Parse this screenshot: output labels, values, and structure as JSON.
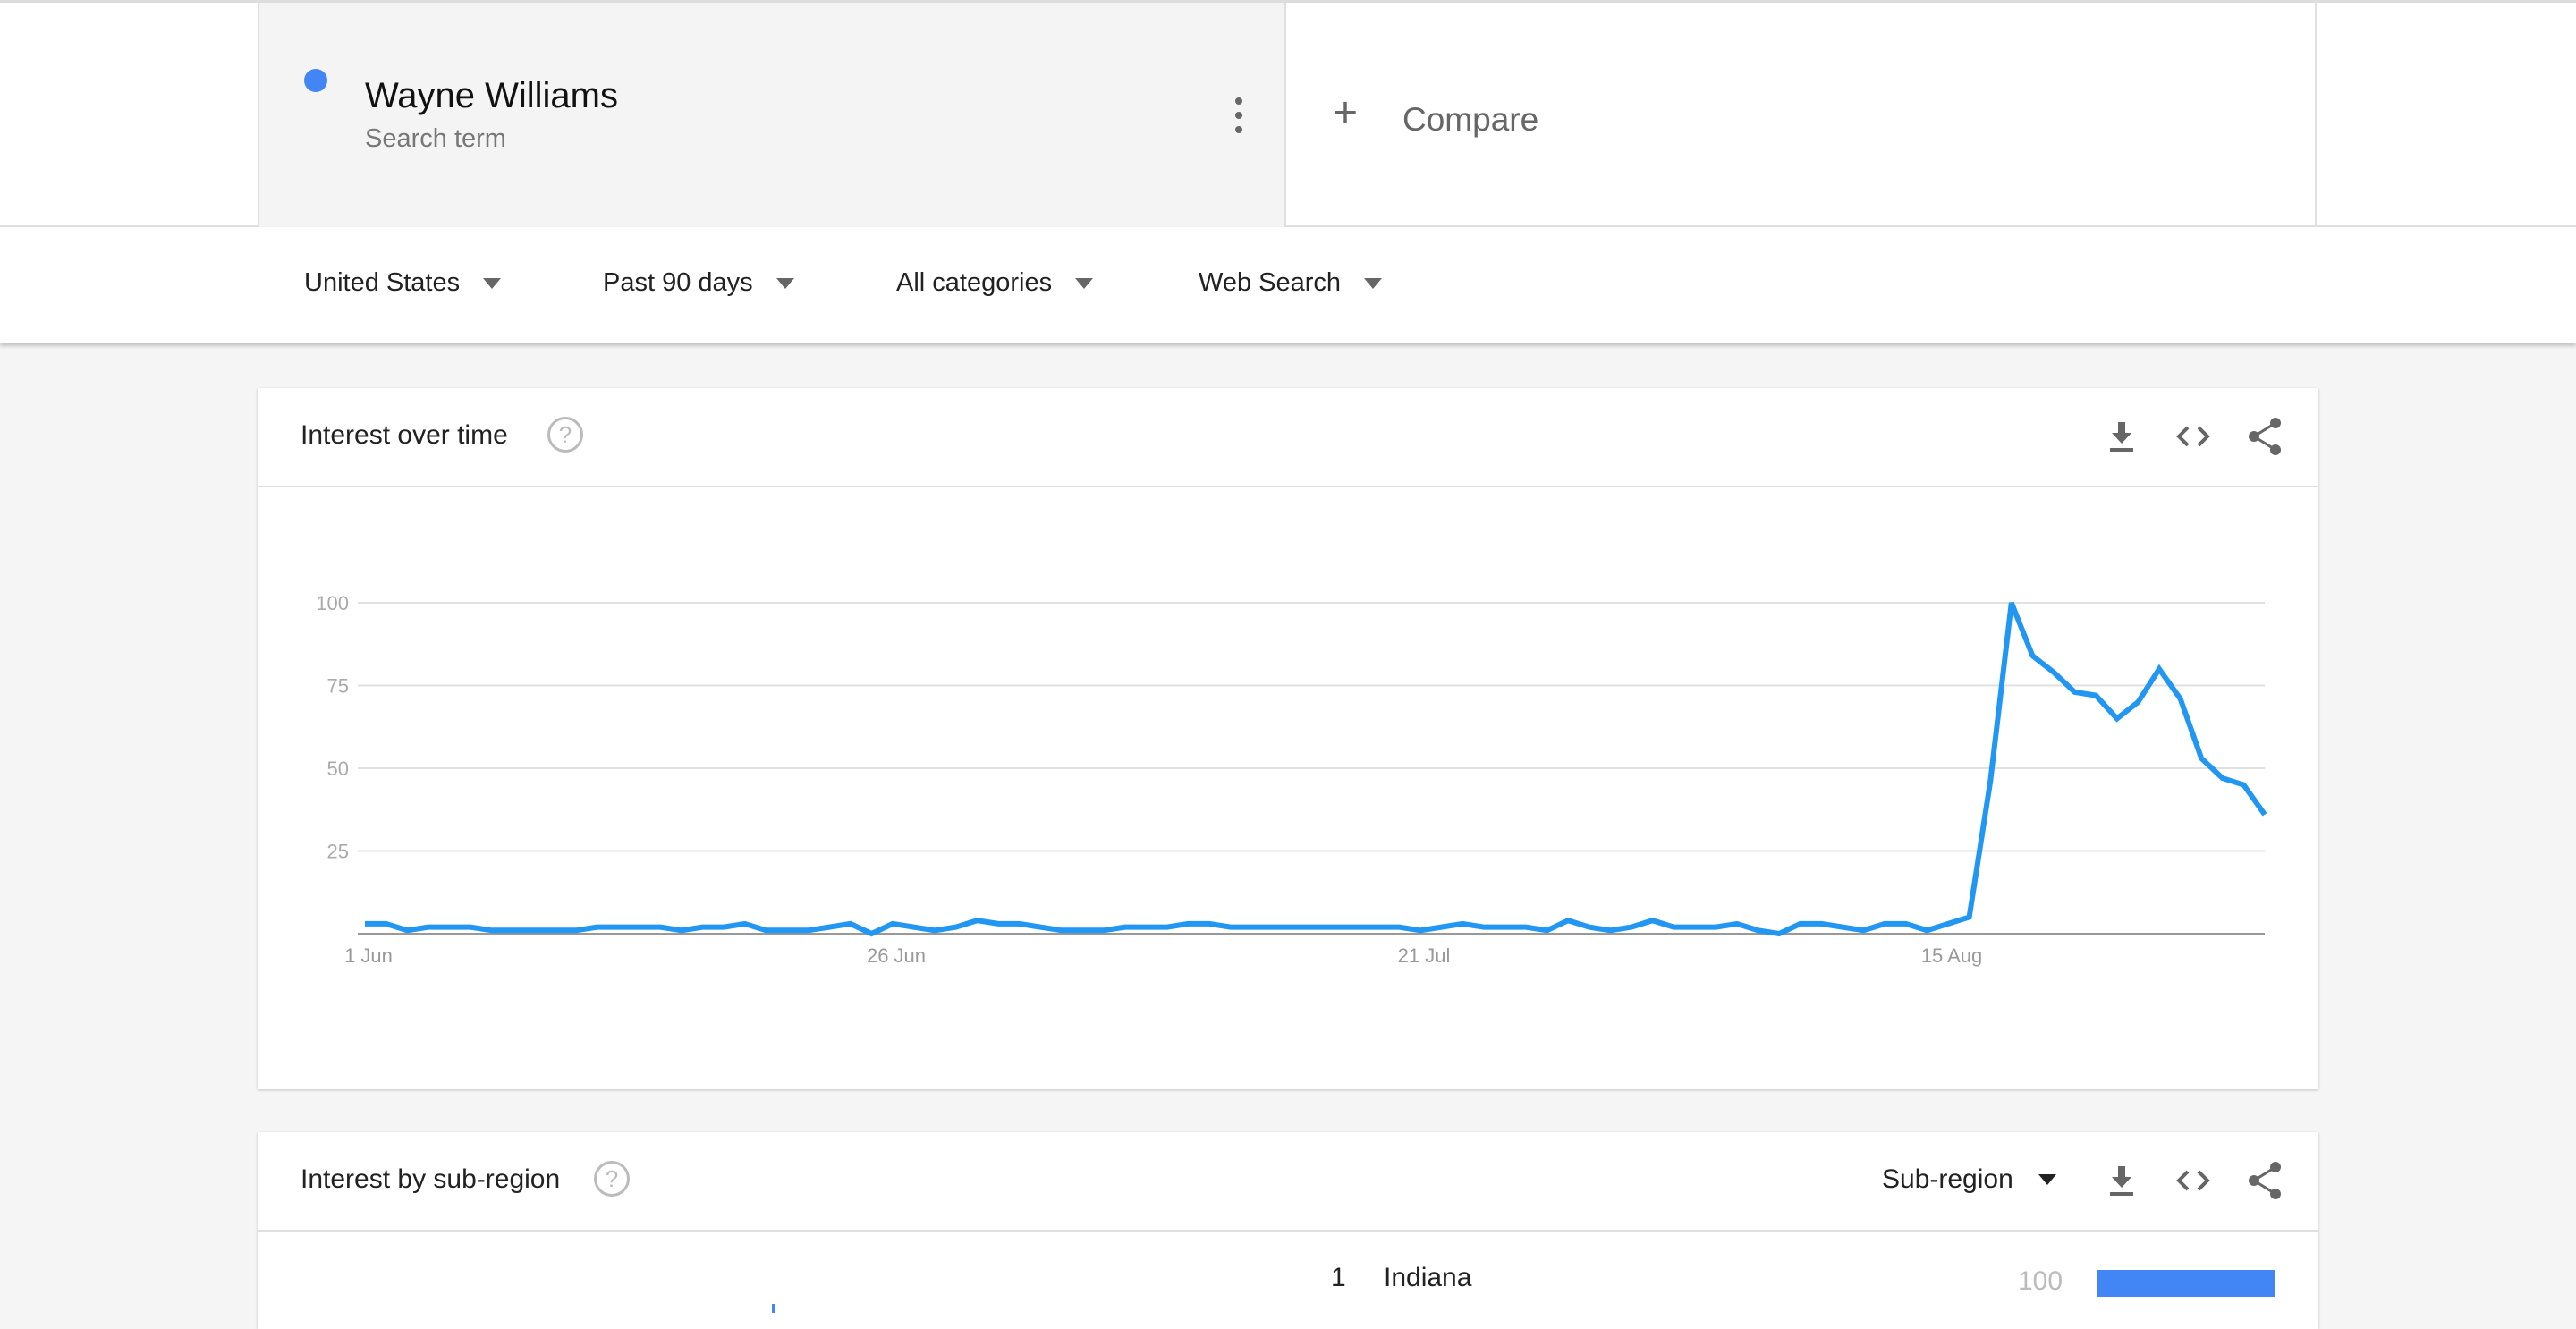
{
  "search_term": {
    "title": "Wayne Williams",
    "subtitle": "Search term",
    "color": "#4285f4"
  },
  "compare": {
    "label": "Compare"
  },
  "filters": [
    "United States",
    "Past 90 days",
    "All categories",
    "Web Search"
  ],
  "interest_over_time": {
    "title": "Interest over time",
    "help_icon": "question-circle-icon"
  },
  "interest_by_subregion": {
    "title": "Interest by sub-region",
    "selector": "Sub-region",
    "rows": [
      {
        "rank": "1",
        "name": "Indiana",
        "value": "100",
        "fraction": 1.0
      }
    ],
    "bar_color": "#4285f4"
  },
  "icons": [
    "download-icon",
    "embed-code-icon",
    "share-icon"
  ],
  "chart_data": {
    "type": "line",
    "ylim": [
      0,
      100
    ],
    "y_ticks": [
      "25",
      "50",
      "75",
      "100"
    ],
    "x_ticks": [
      "1 Jun",
      "26 Jun",
      "21 Jul",
      "15 Aug"
    ],
    "grid": true,
    "color": "#2196f3",
    "x": [
      "1 Jun",
      "2 Jun",
      "3 Jun",
      "4 Jun",
      "5 Jun",
      "6 Jun",
      "7 Jun",
      "8 Jun",
      "9 Jun",
      "10 Jun",
      "11 Jun",
      "12 Jun",
      "13 Jun",
      "14 Jun",
      "15 Jun",
      "16 Jun",
      "17 Jun",
      "18 Jun",
      "19 Jun",
      "20 Jun",
      "21 Jun",
      "22 Jun",
      "23 Jun",
      "24 Jun",
      "25 Jun",
      "26 Jun",
      "27 Jun",
      "28 Jun",
      "29 Jun",
      "30 Jun",
      "1 Jul",
      "2 Jul",
      "3 Jul",
      "4 Jul",
      "5 Jul",
      "6 Jul",
      "7 Jul",
      "8 Jul",
      "9 Jul",
      "10 Jul",
      "11 Jul",
      "12 Jul",
      "13 Jul",
      "14 Jul",
      "15 Jul",
      "16 Jul",
      "17 Jul",
      "18 Jul",
      "19 Jul",
      "20 Jul",
      "21 Jul",
      "22 Jul",
      "23 Jul",
      "24 Jul",
      "25 Jul",
      "26 Jul",
      "27 Jul",
      "28 Jul",
      "29 Jul",
      "30 Jul",
      "31 Jul",
      "1 Aug",
      "2 Aug",
      "3 Aug",
      "4 Aug",
      "5 Aug",
      "6 Aug",
      "7 Aug",
      "8 Aug",
      "9 Aug",
      "10 Aug",
      "11 Aug",
      "12 Aug",
      "13 Aug",
      "14 Aug",
      "15 Aug",
      "16 Aug",
      "17 Aug",
      "18 Aug",
      "19 Aug",
      "20 Aug",
      "21 Aug",
      "22 Aug",
      "23 Aug",
      "24 Aug",
      "25 Aug",
      "26 Aug",
      "27 Aug",
      "28 Aug",
      "29 Aug",
      "30 Aug"
    ],
    "values": [
      3,
      3,
      1,
      2,
      2,
      2,
      1,
      1,
      1,
      1,
      1,
      2,
      2,
      2,
      2,
      1,
      2,
      2,
      3,
      1,
      1,
      1,
      2,
      3,
      0,
      3,
      2,
      1,
      2,
      4,
      3,
      3,
      2,
      1,
      1,
      1,
      2,
      2,
      2,
      3,
      3,
      2,
      2,
      2,
      2,
      2,
      2,
      2,
      2,
      2,
      1,
      2,
      3,
      2,
      2,
      2,
      1,
      4,
      2,
      1,
      2,
      4,
      2,
      2,
      2,
      3,
      1,
      0,
      3,
      3,
      2,
      1,
      3,
      3,
      1,
      3,
      5,
      46,
      100,
      84,
      79,
      73,
      72,
      65,
      70,
      80,
      71,
      53,
      47,
      45,
      36
    ]
  }
}
